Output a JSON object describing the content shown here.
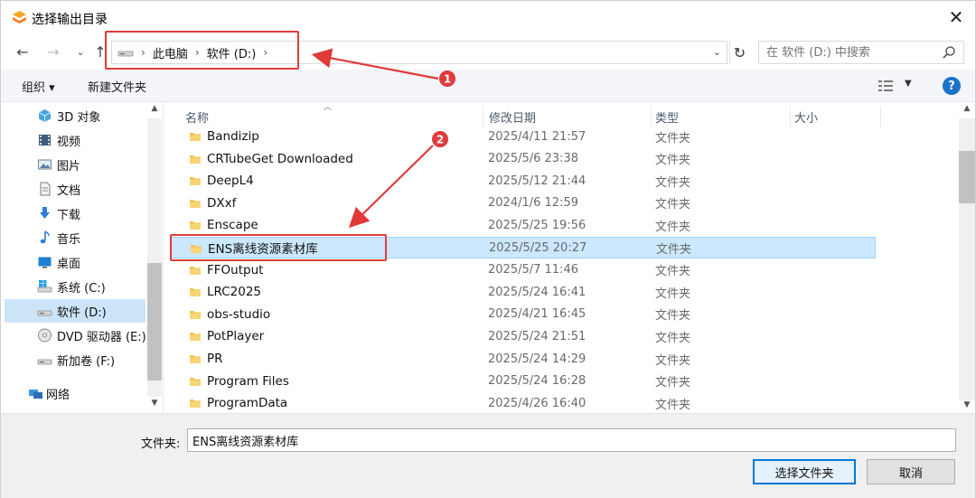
{
  "window": {
    "title": "选择输出目录"
  },
  "nav": {
    "breadcrumb": [
      "此电脑",
      "软件 (D:)"
    ],
    "search_placeholder": "在 软件 (D:) 中搜索"
  },
  "toolbar": {
    "organize": "组织",
    "new_folder": "新建文件夹"
  },
  "sidebar": {
    "items": [
      {
        "label": "3D 对象",
        "icon": "3d-objects-icon"
      },
      {
        "label": "视频",
        "icon": "video-icon"
      },
      {
        "label": "图片",
        "icon": "pictures-icon"
      },
      {
        "label": "文档",
        "icon": "documents-icon"
      },
      {
        "label": "下载",
        "icon": "download-icon"
      },
      {
        "label": "音乐",
        "icon": "music-icon"
      },
      {
        "label": "桌面",
        "icon": "desktop-icon"
      },
      {
        "label": "系统 (C:)",
        "icon": "system-drive-icon"
      },
      {
        "label": "软件 (D:)",
        "icon": "drive-icon",
        "selected": true
      },
      {
        "label": "DVD 驱动器 (E:)",
        "icon": "dvd-icon"
      },
      {
        "label": "新加卷 (F:)",
        "icon": "drive-icon"
      },
      {
        "label": "网络",
        "icon": "network-icon"
      }
    ]
  },
  "columns": {
    "name": "名称",
    "date": "修改日期",
    "type": "类型",
    "size": "大小"
  },
  "files": [
    {
      "name": "Bandizip",
      "date": "2025/4/11 21:57",
      "type": "文件夹"
    },
    {
      "name": "CRTubeGet Downloaded",
      "date": "2025/5/6 23:38",
      "type": "文件夹"
    },
    {
      "name": "DeepL4",
      "date": "2025/5/12 21:44",
      "type": "文件夹"
    },
    {
      "name": "DXxf",
      "date": "2024/1/6 12:59",
      "type": "文件夹"
    },
    {
      "name": "Enscape",
      "date": "2025/5/25 19:56",
      "type": "文件夹"
    },
    {
      "name": "ENS离线资源素材库",
      "date": "2025/5/25 20:27",
      "type": "文件夹",
      "selected": true
    },
    {
      "name": "FFOutput",
      "date": "2025/5/7 11:46",
      "type": "文件夹"
    },
    {
      "name": "LRC2025",
      "date": "2025/5/24 16:41",
      "type": "文件夹"
    },
    {
      "name": "obs-studio",
      "date": "2025/4/21 16:45",
      "type": "文件夹"
    },
    {
      "name": "PotPlayer",
      "date": "2025/5/24 21:51",
      "type": "文件夹"
    },
    {
      "name": "PR",
      "date": "2025/5/24 14:29",
      "type": "文件夹"
    },
    {
      "name": "Program Files",
      "date": "2025/5/24 16:28",
      "type": "文件夹"
    },
    {
      "name": "ProgramData",
      "date": "2025/4/26 16:40",
      "type": "文件夹"
    }
  ],
  "bottom": {
    "folder_label": "文件夹:",
    "folder_value": "ENS离线资源素材库",
    "select_button": "选择文件夹",
    "cancel_button": "取消"
  },
  "annotations": {
    "marker_1": "1",
    "marker_2": "2",
    "color": "#e03a3a"
  },
  "colors": {
    "selection": "#cce8ff",
    "accent": "#0078d7",
    "folder": "#f2c24a"
  }
}
